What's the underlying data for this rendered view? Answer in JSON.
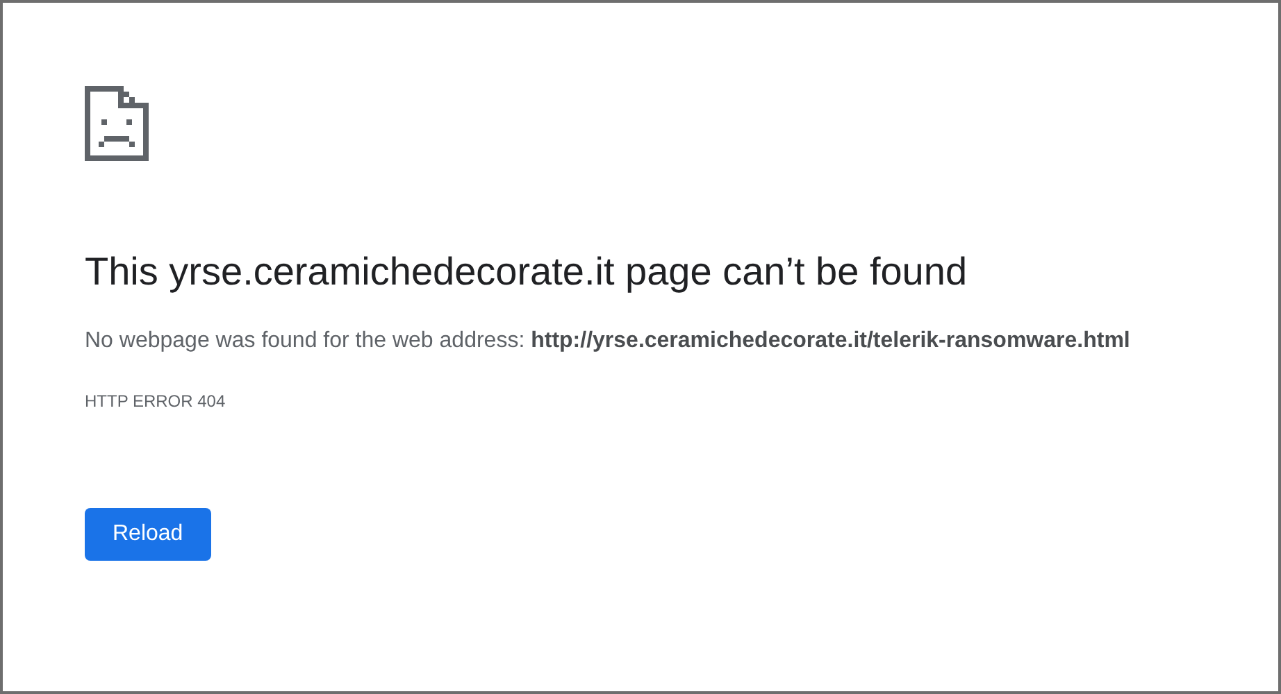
{
  "title": "This yrse.ceramichedecorate.it page can’t be found",
  "message": "No webpage was found for the web address: **http://yrse.ceramichedecorate.it/telerik-ransomware.html**",
  "error_code": "HTTP ERROR 404",
  "buttons": [
    "Reload"
  ]
}
